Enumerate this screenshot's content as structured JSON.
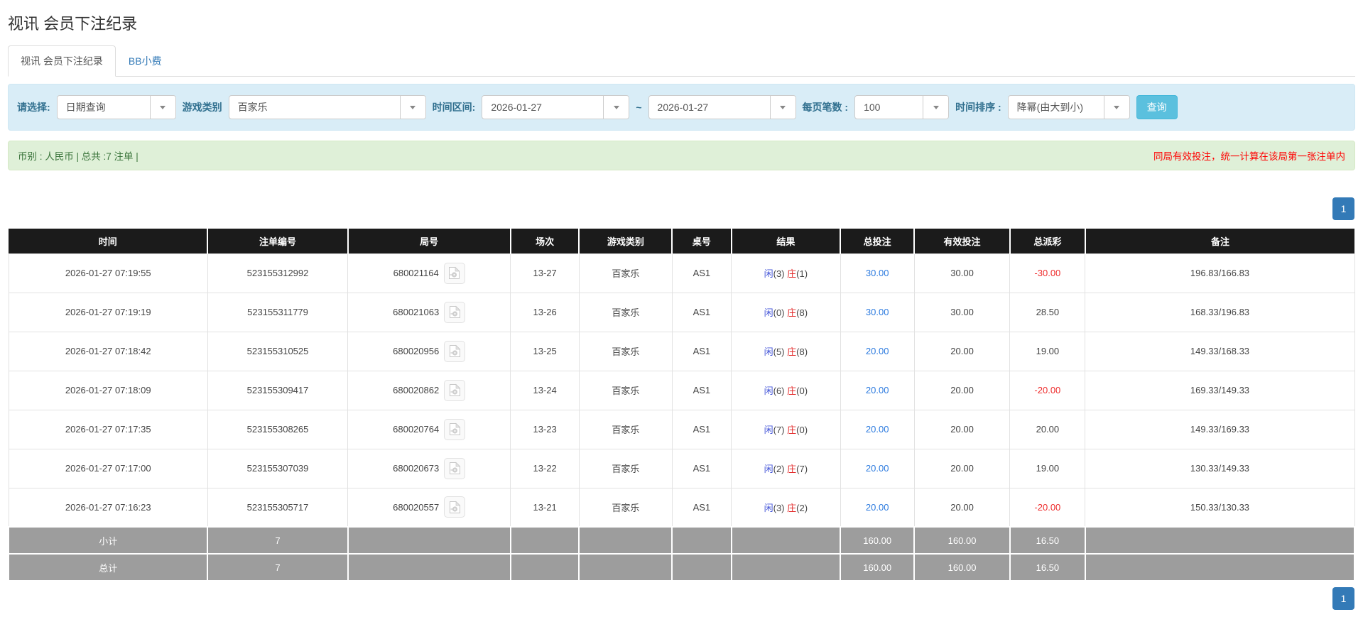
{
  "title": "视讯 会员下注纪录",
  "tabs": {
    "records_tab": "视讯 会员下注纪录",
    "tip_tab": "BB小费"
  },
  "filters": {
    "select_label": "请选择:",
    "select_value": "日期查询",
    "game_label": "游戏类别",
    "game_value": "百家乐",
    "range_label": "时间区间:",
    "date_from": "2026-01-27",
    "tilde": "~",
    "date_to": "2026-01-27",
    "page_size_label": "每页笔数 :",
    "page_size_value": "100",
    "sort_label": "时间排序 :",
    "sort_value": "降幂(由大到小)",
    "search_button": "查询"
  },
  "summary_bar": {
    "left": "币别 : 人民币 | 总共 :7 注单 |",
    "right": "同局有效投注，统一计算在该局第一张注单内"
  },
  "pagination": {
    "page": "1"
  },
  "table": {
    "headers": [
      "时间",
      "注单编号",
      "局号",
      "场次",
      "游戏类别",
      "桌号",
      "结果",
      "总投注",
      "有效投注",
      "总派彩",
      "备注"
    ],
    "col_widths": [
      "14.8%",
      "10.4%",
      "12.1%",
      "5.1%",
      "6.9%",
      "4.4%",
      "8.1%",
      "5.5%",
      "7.1%",
      "5.6%",
      "20%"
    ],
    "rows": [
      {
        "time": "2026-01-27 07:19:55",
        "bet_no": "523155312992",
        "round_no": "680021164",
        "session": "13-27",
        "game": "百家乐",
        "table_no": "AS1",
        "player_label": "闲",
        "player_score": "(3)",
        "banker_label": "庄",
        "banker_score": "(1)",
        "total_bet": "30.00",
        "valid_bet": "30.00",
        "payout": "-30.00",
        "payout_negative": true,
        "remark": "196.83/166.83"
      },
      {
        "time": "2026-01-27 07:19:19",
        "bet_no": "523155311779",
        "round_no": "680021063",
        "session": "13-26",
        "game": "百家乐",
        "table_no": "AS1",
        "player_label": "闲",
        "player_score": "(0)",
        "banker_label": "庄",
        "banker_score": "(8)",
        "total_bet": "30.00",
        "valid_bet": "30.00",
        "payout": "28.50",
        "payout_negative": false,
        "remark": "168.33/196.83"
      },
      {
        "time": "2026-01-27 07:18:42",
        "bet_no": "523155310525",
        "round_no": "680020956",
        "session": "13-25",
        "game": "百家乐",
        "table_no": "AS1",
        "player_label": "闲",
        "player_score": "(5)",
        "banker_label": "庄",
        "banker_score": "(8)",
        "total_bet": "20.00",
        "valid_bet": "20.00",
        "payout": "19.00",
        "payout_negative": false,
        "remark": "149.33/168.33"
      },
      {
        "time": "2026-01-27 07:18:09",
        "bet_no": "523155309417",
        "round_no": "680020862",
        "session": "13-24",
        "game": "百家乐",
        "table_no": "AS1",
        "player_label": "闲",
        "player_score": "(6)",
        "banker_label": "庄",
        "banker_score": "(0)",
        "total_bet": "20.00",
        "valid_bet": "20.00",
        "payout": "-20.00",
        "payout_negative": true,
        "remark": "169.33/149.33"
      },
      {
        "time": "2026-01-27 07:17:35",
        "bet_no": "523155308265",
        "round_no": "680020764",
        "session": "13-23",
        "game": "百家乐",
        "table_no": "AS1",
        "player_label": "闲",
        "player_score": "(7)",
        "banker_label": "庄",
        "banker_score": "(0)",
        "total_bet": "20.00",
        "valid_bet": "20.00",
        "payout": "20.00",
        "payout_negative": false,
        "remark": "149.33/169.33"
      },
      {
        "time": "2026-01-27 07:17:00",
        "bet_no": "523155307039",
        "round_no": "680020673",
        "session": "13-22",
        "game": "百家乐",
        "table_no": "AS1",
        "player_label": "闲",
        "player_score": "(2)",
        "banker_label": "庄",
        "banker_score": "(7)",
        "total_bet": "20.00",
        "valid_bet": "20.00",
        "payout": "19.00",
        "payout_negative": false,
        "remark": "130.33/149.33"
      },
      {
        "time": "2026-01-27 07:16:23",
        "bet_no": "523155305717",
        "round_no": "680020557",
        "session": "13-21",
        "game": "百家乐",
        "table_no": "AS1",
        "player_label": "闲",
        "player_score": "(3)",
        "banker_label": "庄",
        "banker_score": "(2)",
        "total_bet": "20.00",
        "valid_bet": "20.00",
        "payout": "-20.00",
        "payout_negative": true,
        "remark": "150.33/130.33"
      }
    ],
    "summary": [
      {
        "label": "小计",
        "count": "7",
        "total_bet": "160.00",
        "valid_bet": "160.00",
        "payout": "16.50"
      },
      {
        "label": "总计",
        "count": "7",
        "total_bet": "160.00",
        "valid_bet": "160.00",
        "payout": "16.50"
      }
    ]
  },
  "colors": {
    "link_blue": "#337ab7",
    "amount_blue": "#2d7bdf",
    "player_blue": "#4355d8",
    "banker_red": "#e32c2c",
    "negative_red": "#ee2c2c",
    "header_bg": "#1b1b1b",
    "summary_row_bg": "#9d9d9d",
    "filter_bg": "#d9edf7",
    "alert_bg": "#dff0d8",
    "alert_text": "#3c763d",
    "alert_warn_text": "#ff0000",
    "search_btn_bg": "#5bc0de",
    "pager_btn_bg": "#337ab7"
  }
}
